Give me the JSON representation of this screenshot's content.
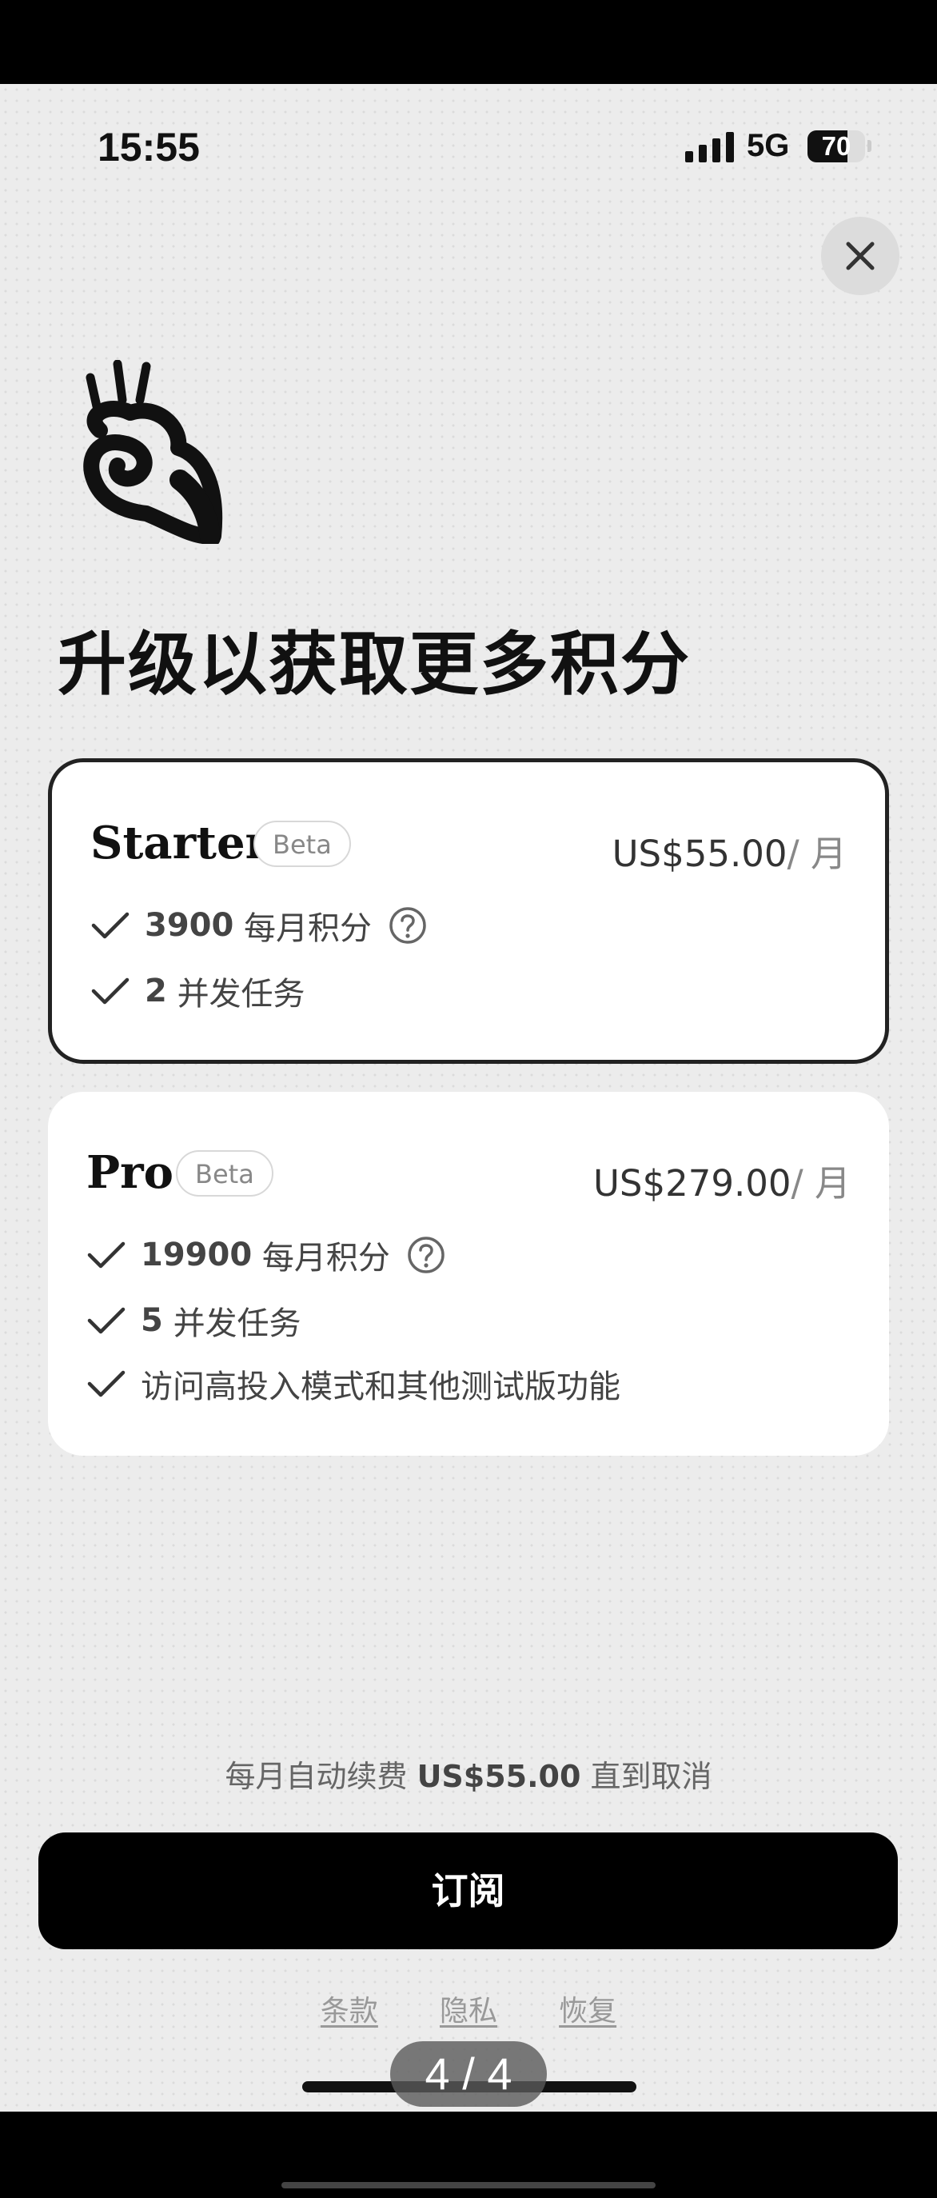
{
  "status_bar": {
    "time": "15:55",
    "network": "5G",
    "battery_level": "70"
  },
  "headline": "升级以获取更多积分",
  "plans": [
    {
      "name": "Starter",
      "badge": "Beta",
      "price": "US$55.00",
      "period": "/ 月",
      "selected": true,
      "features": [
        {
          "number": "3900",
          "text": "每月积分",
          "has_help": true
        },
        {
          "number": "2",
          "text": "并发任务",
          "has_help": false
        }
      ]
    },
    {
      "name": "Pro",
      "badge": "Beta",
      "price": "US$279.00",
      "period": "/ 月",
      "selected": false,
      "features": [
        {
          "number": "19900",
          "text": "每月积分",
          "has_help": true
        },
        {
          "number": "5",
          "text": "并发任务",
          "has_help": false
        },
        {
          "number": "",
          "text": "访问高投入模式和其他测试版功能",
          "has_help": false
        }
      ]
    }
  ],
  "renewal": {
    "prefix": "每月自动续费",
    "amount": "US$55.00",
    "suffix": "直到取消"
  },
  "subscribe_label": "订阅",
  "links": {
    "terms": "条款",
    "privacy": "隐私",
    "restore": "恢复"
  },
  "page_indicator": "4 / 4",
  "icons": {
    "close": "close-icon",
    "check": "check-icon",
    "help": "help-circle-icon",
    "logo": "hand-logo-icon",
    "signal": "signal-icon",
    "battery": "battery-icon"
  },
  "colors": {
    "accent": "#000000",
    "card": "#ffffff",
    "background": "#ececec",
    "muted": "#888888"
  }
}
